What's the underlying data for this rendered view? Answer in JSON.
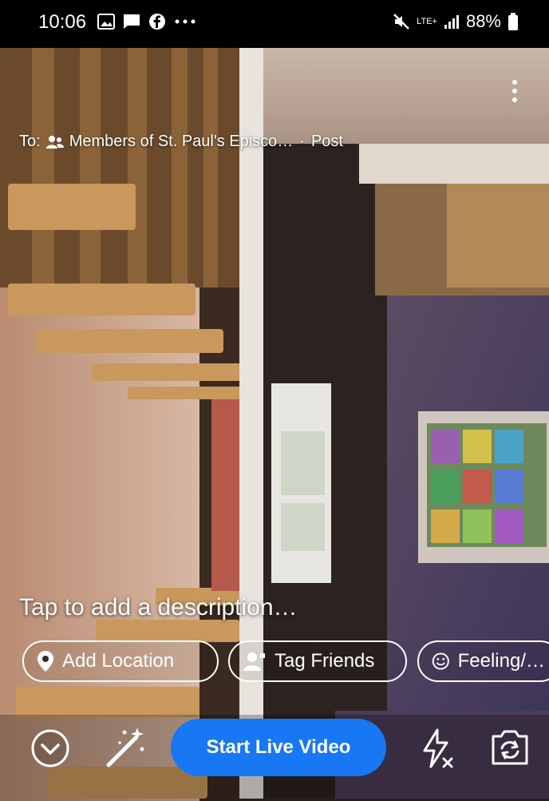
{
  "status_bar": {
    "time": "10:06",
    "network": "LTE+",
    "battery": "88%"
  },
  "composer": {
    "to_label": "To:",
    "audience": "Members of St. Paul's Episco…",
    "separator": "·",
    "post_type": "Post",
    "description_placeholder": "Tap to add a description…"
  },
  "chips": [
    {
      "label": "Add Location",
      "icon": "location-pin-icon"
    },
    {
      "label": "Tag Friends",
      "icon": "tag-friends-icon"
    },
    {
      "label": "Feeling/…",
      "icon": "smiley-icon"
    }
  ],
  "bottom": {
    "start_label": "Start Live Video",
    "accent": "#1877f2"
  }
}
